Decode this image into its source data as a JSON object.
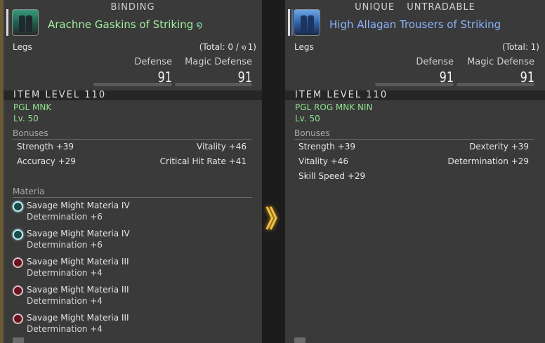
{
  "left": {
    "flags": [
      "BINDING"
    ],
    "item_name": "Arachne Gaskins of Striking",
    "slot": "Legs",
    "total": "(Total: 0 / ",
    "total_glam": "1)",
    "stats": {
      "defense_label": "Defense",
      "defense": "91",
      "magic_defense_label": "Magic Defense",
      "magic_defense": "91"
    },
    "item_level": "ITEM LEVEL 110",
    "jobs": "PGL MNK",
    "level": "Lv. 50",
    "bonuses_label": "Bonuses",
    "bonuses": [
      {
        "left": "Strength +39",
        "right": "Vitality +46"
      },
      {
        "left": "Accuracy +29",
        "right": "Critical Hit Rate +41"
      }
    ],
    "materia_label": "Materia",
    "materia": [
      {
        "name": "Savage Might Materia IV",
        "bonus": "Determination +6",
        "kind": "might"
      },
      {
        "name": "Savage Might Materia IV",
        "bonus": "Determination +6",
        "kind": "might"
      },
      {
        "name": "Savage Might Materia III",
        "bonus": "Determination +4",
        "kind": "red"
      },
      {
        "name": "Savage Might Materia III",
        "bonus": "Determination +4",
        "kind": "red"
      },
      {
        "name": "Savage Might Materia III",
        "bonus": "Determination +4",
        "kind": "red"
      }
    ]
  },
  "right": {
    "flags": [
      "UNIQUE",
      "UNTRADABLE"
    ],
    "item_name": "High Allagan Trousers of Striking",
    "slot": "Legs",
    "total": "(Total: 1)",
    "stats": {
      "defense_label": "Defense",
      "defense": "91",
      "magic_defense_label": "Magic Defense",
      "magic_defense": "91"
    },
    "item_level": "ITEM LEVEL 110",
    "jobs": "PGL ROG MNK NIN",
    "level": "Lv. 50",
    "bonuses_label": "Bonuses",
    "bonuses": [
      {
        "left": "Strength +39",
        "right": "Dexterity +39"
      },
      {
        "left": "Vitality +46",
        "right": "Determination +29"
      },
      {
        "left": "Skill Speed +29",
        "right": ""
      }
    ]
  },
  "compare_arrow": "》",
  "icons": {
    "glamour": "glamour-swirl-icon",
    "left_item": "gaskins-icon",
    "right_item": "trousers-icon"
  },
  "colors": {
    "green_name": "#9ff09f",
    "blue_name": "#8ab4ff",
    "job_text": "#8fe08f",
    "arrow": "#f0c040"
  }
}
